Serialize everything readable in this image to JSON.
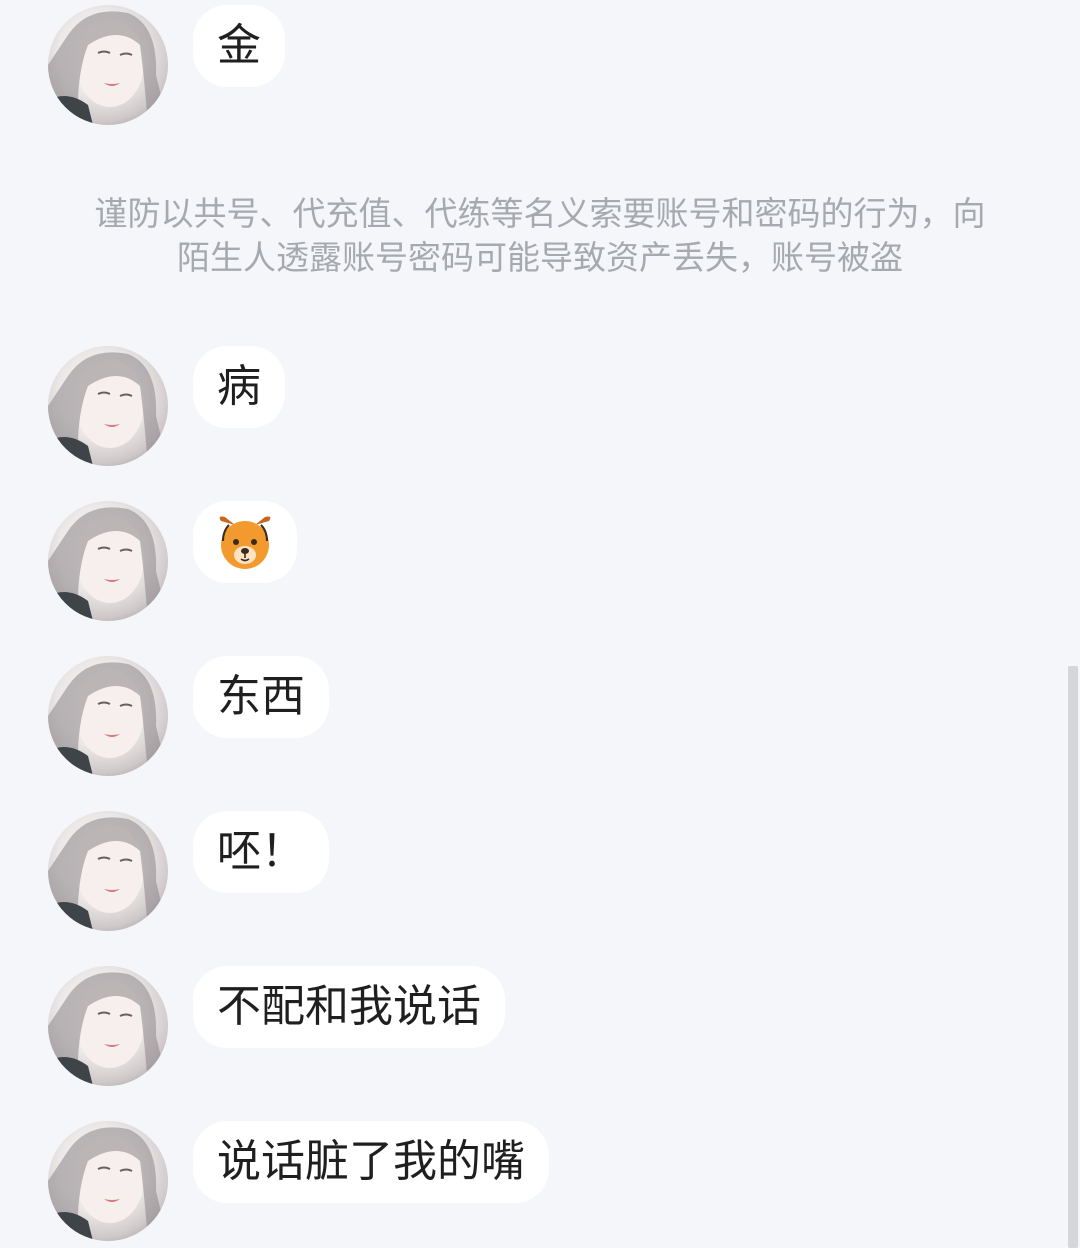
{
  "notice": {
    "text": "谨防以共号、代充值、代练等名义索要账号和密码的行为，向陌生人透露账号密码可能导致资产丢失，账号被盗"
  },
  "messages": [
    {
      "text": "金"
    },
    {
      "text": "病"
    },
    {
      "text": "",
      "icon": "dog-face-emoji-icon"
    },
    {
      "text": "东西"
    },
    {
      "text": "呸！"
    },
    {
      "text": "不配和我说话"
    },
    {
      "text": "说话脏了我的嘴"
    }
  ],
  "colors": {
    "background": "#f4f6f9",
    "bubble": "#ffffff",
    "notice_text": "#a6a9ae",
    "emoji_orange": "#f29a2e"
  }
}
